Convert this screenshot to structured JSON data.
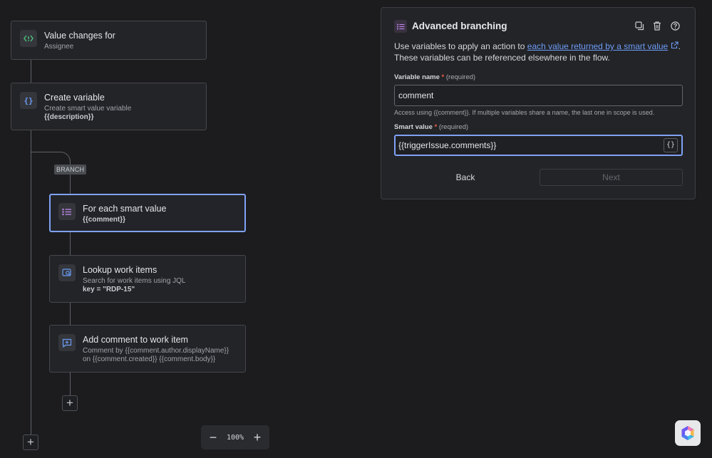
{
  "nodes": {
    "trigger": {
      "title": "Value changes for",
      "sub": "Assignee",
      "icon": "{!}"
    },
    "create_variable": {
      "title": "Create variable",
      "sub": "Create smart value variable",
      "sub2": "{{description}}",
      "icon": "{}"
    },
    "for_each": {
      "title": "For each smart value",
      "sub": "{{comment}}"
    },
    "lookup": {
      "title": "Lookup work items",
      "sub": "Search for work items using JQL",
      "sub2": "key = \"RDP-15\""
    },
    "add_comment": {
      "title": "Add comment to work item",
      "sub": "Comment by {{comment.author.displayName}}",
      "sub2": "on {{comment.created}} {{comment.body}}"
    }
  },
  "branch_tag": "BRANCH",
  "add_symbol": "+",
  "zoom": {
    "minus": "−",
    "value": "100%",
    "plus": "+"
  },
  "panel": {
    "title": "Advanced branching",
    "desc_before": "Use variables to apply an action to ",
    "desc_link": "each value returned by a smart value",
    "desc_after": ". These variables can be referenced elsewhere in the flow.",
    "variable_name": {
      "label": "Variable name",
      "required_mark": "*",
      "required_text": "(required)",
      "value": "comment",
      "help": "Access using {{comment}}. If multiple variables share a name, the last one in scope is used."
    },
    "smart_value": {
      "label": "Smart value",
      "required_mark": "*",
      "required_text": "(required)",
      "value": "{{triggerIssue.comments}}",
      "button": "{}"
    },
    "back_label": "Back",
    "next_label": "Next"
  },
  "icons": {
    "trigger": "code-bracket-icon",
    "create_variable": "curly-braces-icon",
    "for_each": "list-icon",
    "lookup": "search-issue-icon",
    "add_comment": "comment-add-icon",
    "panel": "list-icon",
    "duplicate": "duplicate-icon",
    "delete": "trash-icon",
    "help": "help-icon",
    "external": "external-link-icon",
    "fab": "hexagon-logo-icon"
  },
  "colors": {
    "accent": "#7ea2f5",
    "link": "#6c9cf8",
    "required": "#f15c4b",
    "trigger_icon": "#4ec27d",
    "variable_icon": "#6b9cf5",
    "branch_icon": "#c189f0",
    "action_icon": "#6b9cf5"
  }
}
